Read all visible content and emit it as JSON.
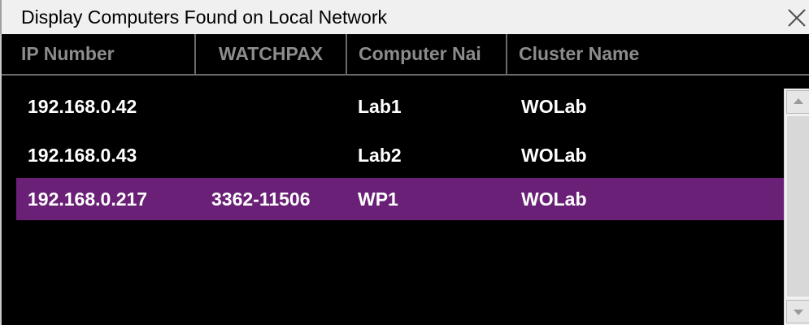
{
  "window": {
    "title": "Display Computers Found on Local Network",
    "close_label": "X"
  },
  "table": {
    "columns": [
      "IP Number",
      "WATCHPAX",
      "Computer Nai",
      "Cluster Name"
    ],
    "rows": [
      {
        "ip": "192.168.0.42",
        "watchpax": "",
        "computer": "Lab1",
        "cluster": "WOLab",
        "selected": false
      },
      {
        "ip": "192.168.0.43",
        "watchpax": "",
        "computer": "Lab2",
        "cluster": "WOLab",
        "selected": false
      },
      {
        "ip": "192.168.0.217",
        "watchpax": "3362-11506",
        "computer": "WP1",
        "cluster": "WOLab",
        "selected": true
      }
    ]
  },
  "colors": {
    "selection": "#6a2077",
    "background": "#000000",
    "header_text": "#8c8c8c"
  }
}
